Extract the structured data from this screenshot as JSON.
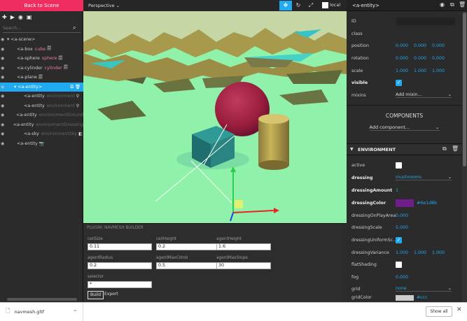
{
  "left_panel": {
    "back_label": "Back to Scene",
    "search_placeholder": "Search...",
    "tree": [
      {
        "tag": "<a-scene>",
        "extra": "",
        "depth": 0,
        "icon": "",
        "arrow": "▾"
      },
      {
        "tag": "<a-box",
        "extra": "cube",
        "depth": 1,
        "icon": "🗐",
        "arrow": ""
      },
      {
        "tag": "<a-sphere",
        "extra": "sphere",
        "depth": 1,
        "icon": "🗐",
        "arrow": ""
      },
      {
        "tag": "<a-cylinder",
        "extra": "cylinder",
        "depth": 1,
        "icon": "🗐",
        "arrow": ""
      },
      {
        "tag": "<a-plane",
        "extra": "",
        "depth": 1,
        "icon": "🗐",
        "arrow": ""
      },
      {
        "tag": "<a-entity>",
        "extra": "",
        "depth": 1,
        "icon": "",
        "arrow": "▾"
      },
      {
        "tag": "<a-entity",
        "extra": "environment",
        "depth": 2,
        "icon": "⚲",
        "arrow": ""
      },
      {
        "tag": "<a-entity",
        "extra": "environment",
        "depth": 2,
        "icon": "⚲",
        "arrow": ""
      },
      {
        "tag": "<a-entity",
        "extra": "environmentGround",
        "depth": 2,
        "icon": "",
        "arrow": ""
      },
      {
        "tag": "<a-entity",
        "extra": "environmentDressing",
        "depth": 2,
        "icon": "",
        "arrow": ""
      },
      {
        "tag": "<a-sky",
        "extra": "environmentSky",
        "depth": 2,
        "icon": "◧",
        "arrow": ""
      },
      {
        "tag": "<a-entity",
        "extra": "",
        "depth": 1,
        "icon": "📷",
        "arrow": ""
      }
    ]
  },
  "viewport": {
    "camera_mode": "Perspective",
    "local_label": "local"
  },
  "navmesh": {
    "title": "PLUGIN: NAVMESH BUILDER",
    "fields": [
      {
        "label": "cellSize",
        "value": "0.11"
      },
      {
        "label": "cellHeight",
        "value": "0.2"
      },
      {
        "label": "agentHeight",
        "value": "1.6"
      },
      {
        "label": "agentRadius",
        "value": "0.2"
      },
      {
        "label": "agentMaxClimb",
        "value": "0.5"
      },
      {
        "label": "agentMaxSlope",
        "value": "30"
      },
      {
        "label": "selector",
        "value": "*"
      }
    ],
    "build_label": "Build",
    "export_label": "Export"
  },
  "inspector": {
    "entity_title": "<a-entity>",
    "id_label": "ID",
    "class_label": "class",
    "position_label": "position",
    "position": [
      "0.000",
      "0.000",
      "0.000"
    ],
    "rotation_label": "rotation",
    "rotation": [
      "0.000",
      "0.000",
      "0.000"
    ],
    "scale_label": "scale",
    "scale": [
      "1.000",
      "1.000",
      "1.000"
    ],
    "visible_label": "visible",
    "mixins_label": "mixins",
    "mixins_select": "Add mixin...",
    "components_title": "COMPONENTS",
    "add_component": "Add component...",
    "env_title": "ENVIRONMENT",
    "active_label": "active",
    "dressing_label": "dressing",
    "dressing_value": "mushrooms",
    "dressing_amount_label": "dressingAmount",
    "dressing_amount": "1",
    "dressing_color_label": "dressingColor",
    "dressing_color": "#6e1d8b",
    "dressing_onplay_label": "dressingOnPlayArea",
    "dressing_onplay": "0.000",
    "dressing_scale_label": "dressingScale",
    "dressing_scale": "5.000",
    "dressing_uniform_label": "dressingUniformSc...",
    "dressing_variance_label": "dressingVariance",
    "dressing_variance": [
      "1.000",
      "1.000",
      "1.000"
    ],
    "flatshading_label": "flatShading",
    "fog_label": "fog",
    "fog": "0.000",
    "grid_label": "grid",
    "grid_value": "none",
    "grid_color_label": "gridColor",
    "grid_color": "#ccc"
  },
  "downloads": {
    "file": "navmesh.gltf",
    "show_all": "Show all"
  },
  "colors": {
    "accent": "#1faaf2",
    "back_button": "#ef2d5e",
    "dressing_swatch": "#6e1d8b",
    "ground": "#8ef0a8"
  }
}
